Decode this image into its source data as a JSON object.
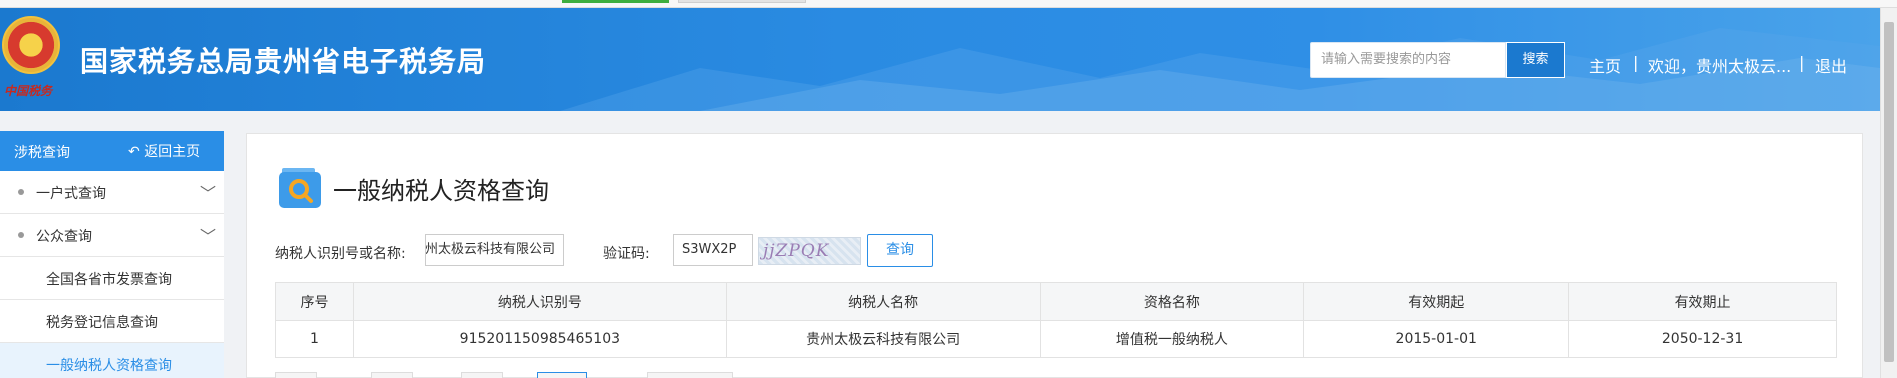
{
  "header": {
    "emblem_text": "中国税务",
    "site_title": "国家税务总局贵州省电子税务局",
    "search": {
      "placeholder": "请输入需要搜索的内容",
      "button": "搜索"
    },
    "nav": {
      "home": "主页",
      "welcome": "欢迎，贵州太极云...",
      "logout": "退出"
    }
  },
  "sidebar": {
    "title": "涉税查询",
    "back": "返回主页",
    "groups": [
      {
        "label": "一户式查询",
        "expanded": false
      },
      {
        "label": "公众查询",
        "expanded": true
      }
    ],
    "subitems": [
      {
        "label": "全国各省市发票查询",
        "active": false
      },
      {
        "label": "税务登记信息查询",
        "active": false
      },
      {
        "label": "一般纳税人资格查询",
        "active": true
      }
    ]
  },
  "main": {
    "title": "一般纳税人资格查询",
    "form": {
      "taxpayer_label": "纳税人识别号或名称:",
      "taxpayer_value": "贵州太极云科技有限公司",
      "captcha_label": "验证码:",
      "captcha_value": "S3WX2P",
      "captcha_image_text": "jjZPQK",
      "query_button": "查询"
    },
    "table": {
      "columns": [
        "序号",
        "纳税人识别号",
        "纳税人名称",
        "资格名称",
        "有效期起",
        "有效期止"
      ],
      "rows": [
        [
          "1",
          "915201150985465103",
          "贵州太极云科技有限公司",
          "增值税一般纳税人",
          "2015-01-01",
          "2050-12-31"
        ]
      ]
    }
  },
  "colors": {
    "header_blue": "#2a8be2",
    "accent_blue": "#2a8ee6",
    "active_bg": "#e8f3fd"
  }
}
